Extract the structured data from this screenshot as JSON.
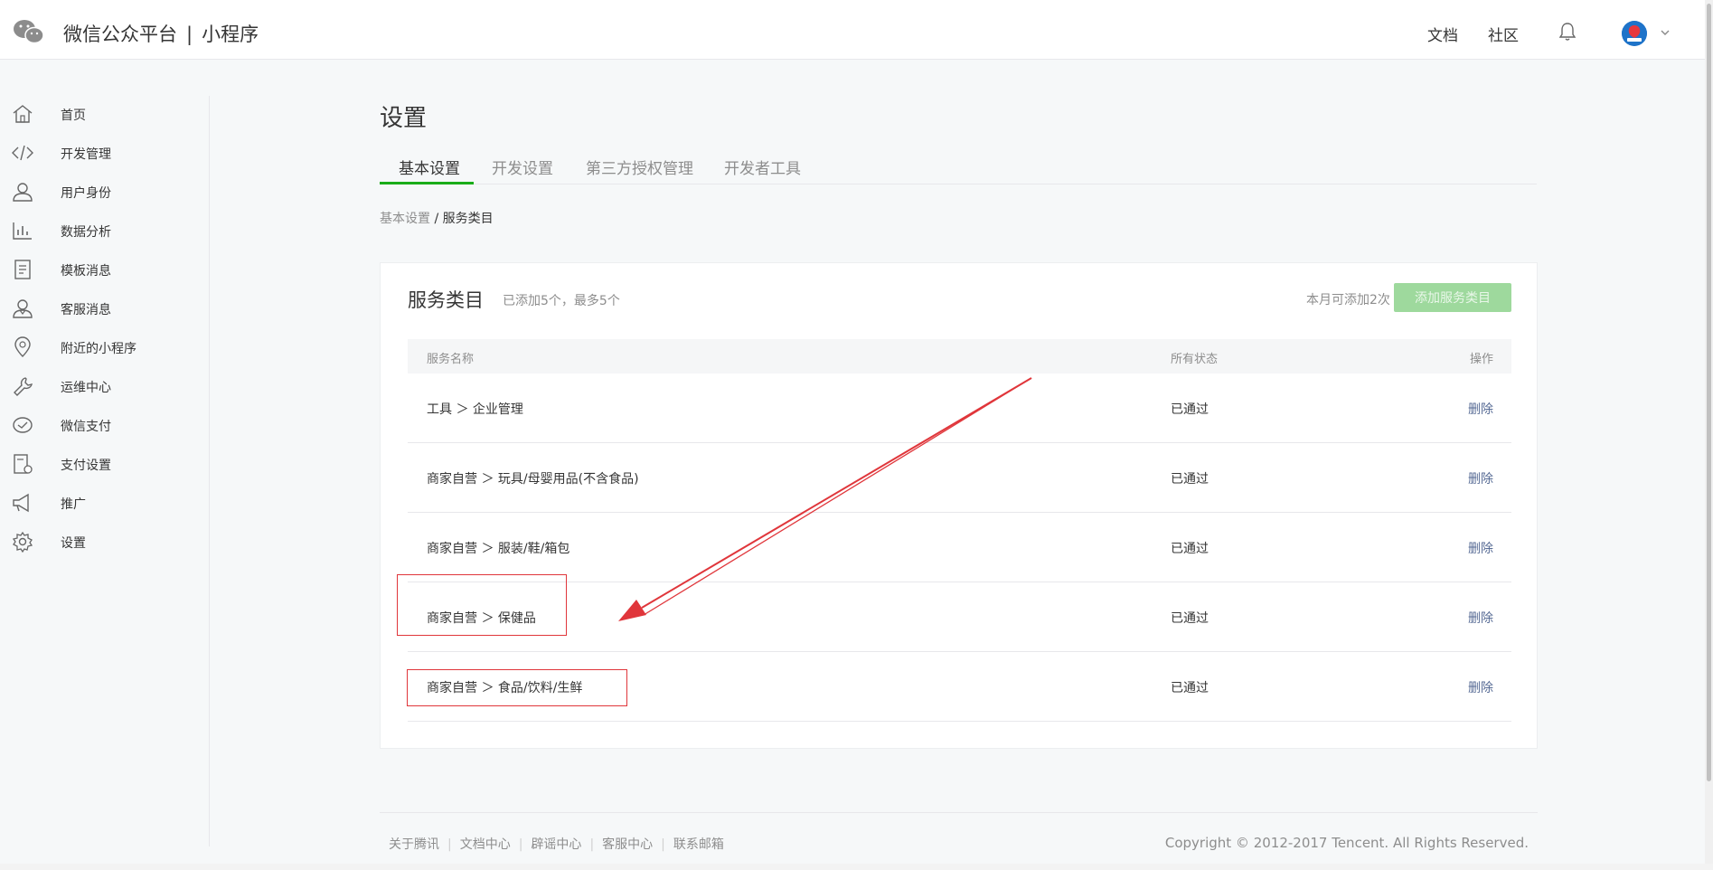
{
  "header": {
    "brand": "微信公众平台",
    "brand_sub": "小程序",
    "docs_link": "文档",
    "community_link": "社区"
  },
  "sidebar": {
    "items": [
      {
        "label": "首页",
        "icon": "home-icon"
      },
      {
        "label": "开发管理",
        "icon": "code-icon"
      },
      {
        "label": "用户身份",
        "icon": "user-icon"
      },
      {
        "label": "数据分析",
        "icon": "chart-icon"
      },
      {
        "label": "模板消息",
        "icon": "document-icon"
      },
      {
        "label": "客服消息",
        "icon": "support-icon"
      },
      {
        "label": "附近的小程序",
        "icon": "location-icon"
      },
      {
        "label": "运维中心",
        "icon": "wrench-icon"
      },
      {
        "label": "微信支付",
        "icon": "pay-icon"
      },
      {
        "label": "支付设置",
        "icon": "pay-settings-icon"
      },
      {
        "label": "推广",
        "icon": "megaphone-icon"
      },
      {
        "label": "设置",
        "icon": "gear-icon"
      }
    ]
  },
  "main": {
    "title": "设置",
    "tabs": [
      {
        "label": "基本设置"
      },
      {
        "label": "开发设置"
      },
      {
        "label": "第三方授权管理"
      },
      {
        "label": "开发者工具"
      }
    ],
    "breadcrumb": {
      "parent": "基本设置",
      "separator": "/",
      "current": "服务类目"
    }
  },
  "card": {
    "title": "服务类目",
    "subtitle": "已添加5个，最多5个",
    "quota": "本月可添加2次",
    "add_button": "添加服务类目",
    "columns": {
      "name": "服务名称",
      "status": "所有状态",
      "action": "操作"
    },
    "rows": [
      {
        "name": "工具 ＞ 企业管理",
        "status": "已通过",
        "action": "删除"
      },
      {
        "name": "商家自营 ＞ 玩具/母婴用品(不含食品)",
        "status": "已通过",
        "action": "删除"
      },
      {
        "name": "商家自营 ＞ 服装/鞋/箱包",
        "status": "已通过",
        "action": "删除"
      },
      {
        "name": "商家自营 ＞ 保健品",
        "status": "已通过",
        "action": "删除"
      },
      {
        "name": "商家自营 ＞ 食品/饮料/生鲜",
        "status": "已通过",
        "action": "删除"
      }
    ]
  },
  "footer": {
    "links": [
      "关于腾讯",
      "文档中心",
      "辟谣中心",
      "客服中心",
      "联系邮箱"
    ],
    "copyright": "Copyright © 2012-2017 Tencent. All Rights Reserved."
  },
  "colors": {
    "accent": "#1aad19",
    "button_disabled": "#9ed99d",
    "link": "#576b95",
    "annotation": "#e0363b"
  }
}
